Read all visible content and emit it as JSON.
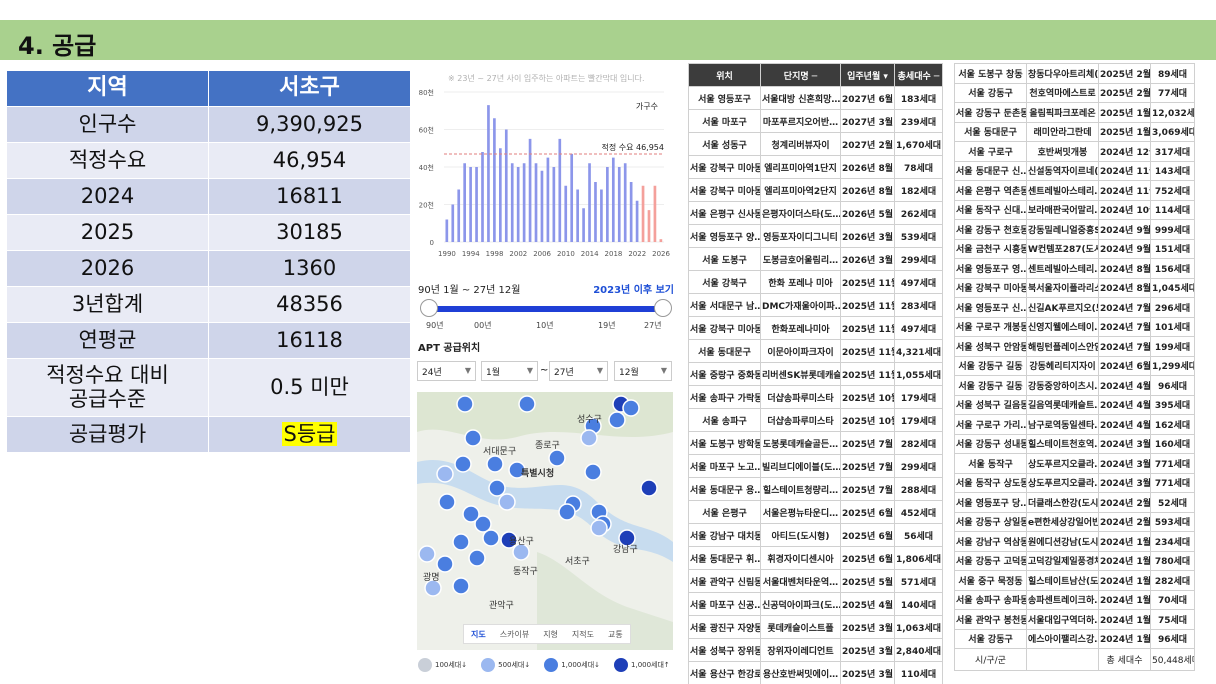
{
  "header": {
    "title": "4. 공급"
  },
  "summary": {
    "head": [
      "지역",
      "서초구"
    ],
    "rows": [
      [
        "인구수",
        "9,390,925"
      ],
      [
        "적정수요",
        "46,954"
      ],
      [
        "2024",
        "16811"
      ],
      [
        "2025",
        "30185"
      ],
      [
        "2026",
        "1360"
      ],
      [
        "3년합계",
        "48356"
      ],
      [
        "연평균",
        "16118"
      ],
      [
        "적정수요 대비\n공급수준",
        "0.5 미만"
      ],
      [
        "공급평가",
        "S등급"
      ]
    ]
  },
  "chart_note": "※ 23년 ~ 27년 사이 입주하는 아파트는 빨간막대 입니다.",
  "chart_data": {
    "type": "bar",
    "legend": "가구수",
    "reference_label": "적정 수요 46,954",
    "reference_value": 46954,
    "y_ticks": [
      "0",
      "20천",
      "40천",
      "60천",
      "80천"
    ],
    "ylim": [
      0,
      80000
    ],
    "x_ticks": [
      "1990",
      "1994",
      "1998",
      "2002",
      "2006",
      "2010",
      "2014",
      "2018",
      "2022",
      "2026"
    ],
    "categories": [
      1990,
      1991,
      1992,
      1993,
      1994,
      1995,
      1996,
      1997,
      1998,
      1999,
      2000,
      2001,
      2002,
      2003,
      2004,
      2005,
      2006,
      2007,
      2008,
      2009,
      2010,
      2011,
      2012,
      2013,
      2014,
      2015,
      2016,
      2017,
      2018,
      2019,
      2020,
      2021,
      2022,
      2023,
      2024,
      2025,
      2026
    ],
    "values": [
      12000,
      20000,
      28000,
      42000,
      40000,
      40000,
      48000,
      73000,
      66000,
      50000,
      60000,
      42000,
      40000,
      42000,
      55000,
      42000,
      38000,
      45000,
      40000,
      55000,
      30000,
      47000,
      28000,
      18000,
      42000,
      32000,
      28000,
      40000,
      45000,
      40000,
      42000,
      32000,
      22000,
      30000,
      17000,
      30000,
      1500
    ],
    "highlight_from": 2023,
    "colors": {
      "normal": "#8c96ea",
      "highlight": "#f4a09b",
      "reference": "#e27d7d"
    }
  },
  "range": {
    "label": "90년 1월 ~ 27년 12월",
    "link": "2023년 이후 보기",
    "ticks": [
      "90년",
      "00년",
      "10년",
      "19년",
      "27년"
    ]
  },
  "apt": {
    "label": "APT 공급위치",
    "selects": [
      "24년",
      "1월",
      "27년",
      "12월"
    ],
    "tilde": "~"
  },
  "map": {
    "labels": [
      "종로구",
      "특별시청",
      "서대문구",
      "용산구",
      "서초구",
      "강남구",
      "관악구",
      "동작구",
      "광명",
      "성수구"
    ],
    "tabs": [
      "지도",
      "스카이뷰",
      "지형",
      "지적도",
      "교통"
    ],
    "active_tab": "지도"
  },
  "legend": [
    {
      "label": "100세대↓",
      "color": "#c9cfd8"
    },
    {
      "label": "500세대↓",
      "color": "#9bb8f0"
    },
    {
      "label": "1,000세대↓",
      "color": "#4a7ee0"
    },
    {
      "label": "1,000세대↑",
      "color": "#1e3fb8"
    }
  ],
  "table1": {
    "headers": [
      "위치",
      "단지명 ─",
      "입주년월 ▾",
      "총세대수 ─"
    ],
    "rows": [
      [
        "서울 영등포구",
        "서울대방 신혼희망…",
        "2027년 6월",
        "183세대"
      ],
      [
        "서울 마포구",
        "마포푸르지오어반…",
        "2027년 3월",
        "239세대"
      ],
      [
        "서울 성동구",
        "청계리버뷰자이",
        "2027년 2월",
        "1,670세대"
      ],
      [
        "서울 강북구 미아동",
        "엘리프미아역1단지",
        "2026년 8월",
        "78세대"
      ],
      [
        "서울 강북구 미아동",
        "엘리프미아역2단지",
        "2026년 8월",
        "182세대"
      ],
      [
        "서울 은평구 신사동",
        "은평자이더스타(도…",
        "2026년 5월",
        "262세대"
      ],
      [
        "서울 영등포구 양…",
        "영등포자이디그니티",
        "2026년 3월",
        "539세대"
      ],
      [
        "서울 도봉구",
        "도봉금호어울림리…",
        "2026년 3월",
        "299세대"
      ],
      [
        "서울 강북구",
        "한화 포레나 미아",
        "2025년 11월",
        "497세대"
      ],
      [
        "서울 서대문구 남…",
        "DMC가재울아이파…",
        "2025년 11월",
        "283세대"
      ],
      [
        "서울 강북구 미아동",
        "한화포레나미아",
        "2025년 11월",
        "497세대"
      ],
      [
        "서울 동대문구",
        "이문아이파크자이",
        "2025년 11월",
        "4,321세대"
      ],
      [
        "서울 중랑구 중화동",
        "리버센SK뷰롯데캐슬",
        "2025년 11월",
        "1,055세대"
      ],
      [
        "서울 송파구 가락동",
        "더샵송파루미스타",
        "2025년 10월",
        "179세대"
      ],
      [
        "서울 송파구",
        "더샵송파루미스타",
        "2025년 10월",
        "179세대"
      ],
      [
        "서울 도봉구 방학동",
        "도봉롯데캐슬골든…",
        "2025년 7월",
        "282세대"
      ],
      [
        "서울 마포구 노고…",
        "빌리브디에이블(도…",
        "2025년 7월",
        "299세대"
      ],
      [
        "서울 동대문구 용…",
        "힐스테이트청량리…",
        "2025년 7월",
        "288세대"
      ],
      [
        "서울 은평구",
        "서울은평뉴타운디…",
        "2025년 6월",
        "452세대"
      ],
      [
        "서울 강남구 대치동",
        "아티드(도시형)",
        "2025년 6월",
        "56세대"
      ],
      [
        "서울 동대문구 휘…",
        "휘경자이디센시아",
        "2025년 6월",
        "1,806세대"
      ],
      [
        "서울 관악구 신림동",
        "서울대벤처타운역…",
        "2025년 5월",
        "571세대"
      ],
      [
        "서울 마포구 신공…",
        "신공덕아이파크(도…",
        "2025년 4월",
        "140세대"
      ],
      [
        "서울 광진구 자양동",
        "롯데캐슬이스트폴",
        "2025년 3월",
        "1,063세대"
      ],
      [
        "서울 성북구 장위동",
        "장위자이레디언트",
        "2025년 3월",
        "2,840세대"
      ],
      [
        "서울 용산구 한강로",
        "용산호반써밋에이…",
        "2025년 3월",
        "110세대"
      ]
    ]
  },
  "table2": {
    "rows": [
      [
        "서울 도봉구 창동",
        "창동다우아트리체(…",
        "2025년 2월",
        "89세대"
      ],
      [
        "서울 강동구",
        "천호역마에스트로",
        "2025년 2월",
        "77세대"
      ],
      [
        "서울 강동구 둔촌동",
        "올림픽파크포레온",
        "2025년 1월",
        "12,032세대"
      ],
      [
        "서울 동대문구",
        "래미안라그란데",
        "2025년 1월",
        "3,069세대"
      ],
      [
        "서울 구로구",
        "호반써밋개봉",
        "2024년 12월",
        "317세대"
      ],
      [
        "서울 동대문구 신…",
        "신설동역자이르네(…",
        "2024년 11월",
        "143세대"
      ],
      [
        "서울 은평구 역촌동",
        "센트레빌아스테리…",
        "2024년 11월",
        "752세대"
      ],
      [
        "서울 동작구 신대…",
        "보라매판국어말리…",
        "2024년 10월",
        "114세대"
      ],
      [
        "서울 강동구 천호동",
        "강동밀레니얼중흥S…",
        "2024년 9월",
        "999세대"
      ],
      [
        "서울 금천구 시흥동",
        "W컨템포287(도시형)",
        "2024년 9월",
        "151세대"
      ],
      [
        "서울 영등포구 영…",
        "센트레빌아스테리…",
        "2024년 8월",
        "156세대"
      ],
      [
        "서울 강북구 미아동",
        "북서울자이폴라리스",
        "2024년 8월",
        "1,045세대"
      ],
      [
        "서울 영등포구 신…",
        "신길AK푸르지오(도…",
        "2024년 7월",
        "296세대"
      ],
      [
        "서울 구로구 개봉동",
        "신영지웰에스테이…",
        "2024년 7월",
        "101세대"
      ],
      [
        "서울 성북구 안암동",
        "해링턴플레이스안암",
        "2024년 7월",
        "199세대"
      ],
      [
        "서울 강동구 길동",
        "강동헤리티지자이",
        "2024년 6월",
        "1,299세대"
      ],
      [
        "서울 강동구 길동",
        "강동중앙하이츠시…",
        "2024년 4월",
        "96세대"
      ],
      [
        "서울 성북구 길음동",
        "길음역롯데캐슬트…",
        "2024년 4월",
        "395세대"
      ],
      [
        "서울 구로구 가리…",
        "남구로역동일센타…",
        "2024년 4월",
        "162세대"
      ],
      [
        "서울 강동구 성내동",
        "힐스테이트천호역…",
        "2024년 3월",
        "160세대"
      ],
      [
        "서울 동작구",
        "상도푸르지오클라…",
        "2024년 3월",
        "771세대"
      ],
      [
        "서울 동작구 상도동",
        "상도푸르지오클라…",
        "2024년 3월",
        "771세대"
      ],
      [
        "서울 영등포구 당…",
        "더클래스한강(도시형)",
        "2024년 2월",
        "52세대"
      ],
      [
        "서울 강동구 상일동",
        "e편한세상강일어반…",
        "2024년 2월",
        "593세대"
      ],
      [
        "서울 강남구 역삼동",
        "원에디션강남(도시형)",
        "2024년 1월",
        "234세대"
      ],
      [
        "서울 강동구 고덕동",
        "고덕강일제일풍경채",
        "2024년 1월",
        "780세대"
      ],
      [
        "서울 중구 묵정동",
        "힐스테이트남산(도…",
        "2024년 1월",
        "282세대"
      ],
      [
        "서울 송파구 송파동",
        "송파센트레이크하…",
        "2024년 1월",
        "70세대"
      ],
      [
        "서울 관악구 봉천동",
        "서울대입구역더하…",
        "2024년 1월",
        "75세대"
      ],
      [
        "서울 강동구",
        "에스아이팰리스강…",
        "2024년 1월",
        "96세대"
      ]
    ],
    "footer": [
      "시/구/군",
      "",
      "총 세대수",
      "50,448세대"
    ]
  }
}
